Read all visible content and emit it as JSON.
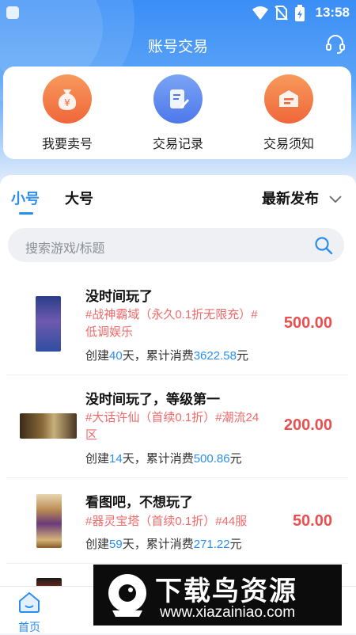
{
  "status_bar": {
    "time": "13:58"
  },
  "header": {
    "title": "账号交易"
  },
  "quick_actions": [
    {
      "label": "我要卖号",
      "icon": "money-bag-icon",
      "color": "#f47a45"
    },
    {
      "label": "交易记录",
      "icon": "document-edit-icon",
      "color": "#5a86ee"
    },
    {
      "label": "交易须知",
      "icon": "notice-icon",
      "color": "#f47a45"
    }
  ],
  "tabs": {
    "small": "小号",
    "large": "大号"
  },
  "sort": {
    "label": "最新发布"
  },
  "search": {
    "placeholder": "搜索游戏/标题"
  },
  "listings": [
    {
      "title": "没时间玩了",
      "tags_line1": "#战神霸域（永久0.1折无限充）#",
      "tags_line2": "低调娱乐",
      "price": "500.00",
      "meta_prefix": "创建",
      "days": "40",
      "meta_mid": "天，累计消费",
      "spend": "3622.58",
      "meta_suffix": "元"
    },
    {
      "title": "没时间玩了，等级第一",
      "tags_line1": "#大话许仙（首续0.1折）#潮流24",
      "tags_line2": "区",
      "price": "200.00",
      "meta_prefix": "创建",
      "days": "14",
      "meta_mid": "天，累计消费",
      "spend": "500.86",
      "meta_suffix": "元"
    },
    {
      "title": "看图吧，不想玩了",
      "tags_line1": "#器灵宝塔（首续0.1折）#44服",
      "tags_line2": "",
      "price": "50.00",
      "meta_prefix": "创建",
      "days": "59",
      "meta_mid": "天，累计消费",
      "spend": "271.22",
      "meta_suffix": "元"
    }
  ],
  "tabbar": {
    "home": "首页"
  },
  "watermark": {
    "title": "下载鸟资源",
    "url": "www.xiazainiao.com"
  },
  "colors": {
    "accent": "#2a8ef0",
    "price": "#e84f4f",
    "tag": "#f06a6a"
  }
}
